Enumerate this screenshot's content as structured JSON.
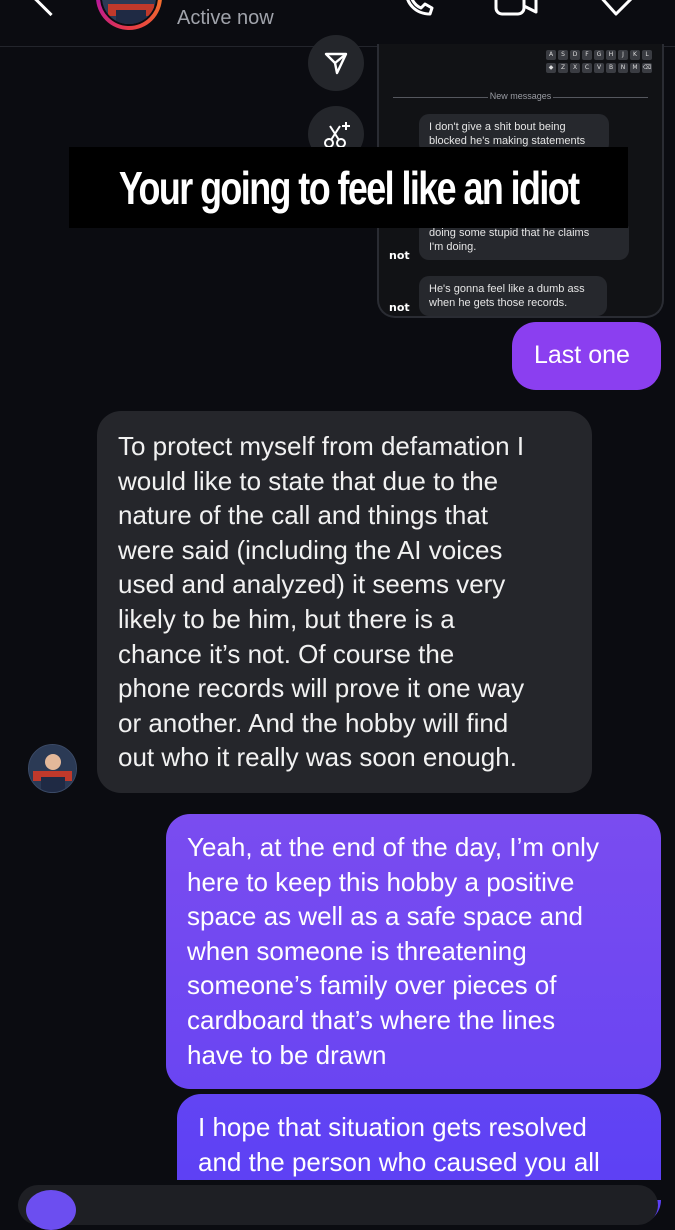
{
  "header": {
    "status": "Active now",
    "icons": [
      "back-chevron-icon",
      "phone-call-icon",
      "video-call-icon",
      "info-icon"
    ]
  },
  "embedded_screenshot": {
    "keyboard_row1": [
      "A",
      "S",
      "D",
      "F",
      "G",
      "H",
      "J",
      "K",
      "L"
    ],
    "keyboard_row2": [
      "◆",
      "Z",
      "X",
      "C",
      "V",
      "B",
      "N",
      "M",
      "⌫"
    ],
    "divider_label": "New messages",
    "messages": [
      {
        "lines": [
          "I don't give a shit bout being",
          "blocked he's making statements"
        ]
      },
      {
        "lines": [
          "doing some stupid that he claims",
          "I'm doing."
        ]
      },
      {
        "lines": [
          "He's gonna feel like a dumb ass",
          "when he gets those records."
        ]
      }
    ],
    "avatar_text": "not"
  },
  "overlay": {
    "text": "Your going to feel like an idiot"
  },
  "conversation": {
    "sent_1": {
      "lines": [
        "Last one"
      ]
    },
    "received_1": {
      "lines": [
        "To protect myself from defamation I",
        "would like to state that due to the",
        "nature of the call and things that",
        "were said (including the AI voices",
        "used and analyzed) it seems very",
        "likely to be him, but there is a",
        "chance it’s not.  Of course the",
        "phone records will prove it one way",
        "or another.  And the hobby will find",
        "out who it really was soon enough."
      ]
    },
    "sent_2": {
      "lines": [
        "Yeah, at the end of the day, I’m only",
        "here to keep this hobby a positive",
        "space as well as a safe space and",
        "when someone is threatening",
        "someone’s family over pieces of",
        "cardboard that’s where the lines",
        "have to be drawn"
      ]
    },
    "sent_3": {
      "lines": [
        "I hope that situation gets resolved",
        "and the person who caused you all"
      ]
    }
  },
  "colors": {
    "background": "#0b0c11",
    "received_bubble": "#25262b",
    "sent_gradient_start": "#7a4cf0",
    "sent_gradient_end": "#5b3ff5",
    "last_one_bubble": "#8b3ff0"
  }
}
